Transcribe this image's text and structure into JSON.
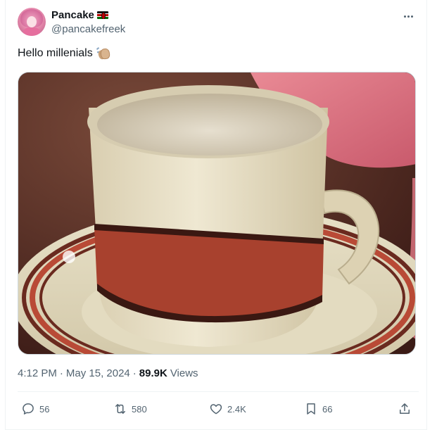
{
  "author": {
    "display_name": "Pancake",
    "handle": "@pancakefreek",
    "flag_icon": "kenya-flag-icon"
  },
  "tweet": {
    "text": "Hello millenials",
    "emoji_icon": "clapping-hands-icon",
    "media_description_icon": "teacup-on-saucer-photo"
  },
  "meta": {
    "time": "4:12 PM",
    "separator": "·",
    "date": "May 15, 2024",
    "views_count": "89.9K",
    "views_label": "Views"
  },
  "actions": {
    "replies": "56",
    "retweets": "580",
    "likes": "2.4K",
    "bookmarks": "66"
  },
  "colors": {
    "text_primary": "#0f1419",
    "text_secondary": "#536471",
    "border": "#eff3f4"
  }
}
